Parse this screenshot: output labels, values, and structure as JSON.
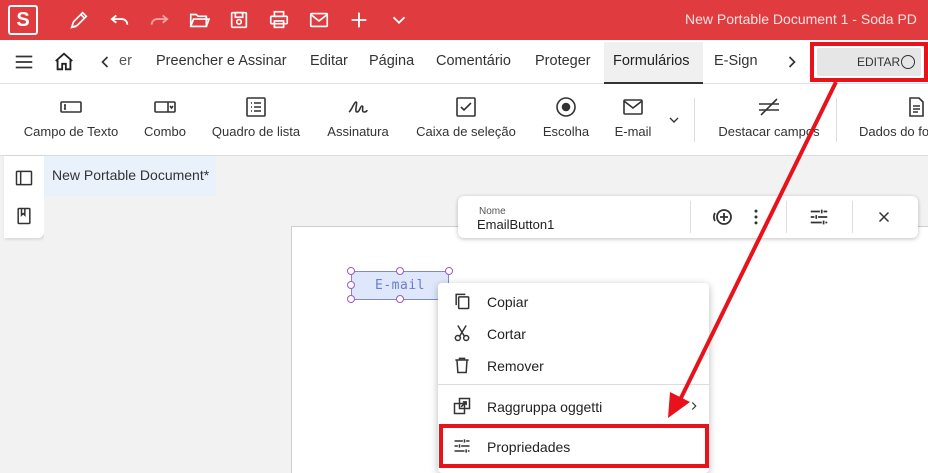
{
  "app": {
    "logo_letter": "S",
    "window_title": "New Portable Document 1  -  Soda PD"
  },
  "quick_access": [
    "pen-icon",
    "undo-icon",
    "redo-icon",
    "open-folder-icon",
    "save-icon",
    "print-icon",
    "mail-icon",
    "plus-icon",
    "chevron-down-icon"
  ],
  "nav_tabs": {
    "partial_left": "er",
    "items": [
      "Preencher e Assinar",
      "Editar",
      "Página",
      "Comentário",
      "Proteger",
      "Formulários",
      "E-Sign"
    ],
    "active": "Formulários",
    "edit_toggle_label": "EDITAR"
  },
  "ribbon": {
    "items": [
      {
        "label": "Campo de Texto",
        "icon": "text-field-icon"
      },
      {
        "label": "Combo",
        "icon": "combo-box-icon"
      },
      {
        "label": "Quadro de lista",
        "icon": "list-box-icon"
      },
      {
        "label": "Assinatura",
        "icon": "signature-icon"
      },
      {
        "label": "Caixa de seleção",
        "icon": "checkbox-icon"
      },
      {
        "label": "Escolha",
        "icon": "radio-icon"
      },
      {
        "label": "E-mail",
        "icon": "mail-icon"
      },
      {
        "label": "Destacar campos",
        "icon": "highlight-fields-icon"
      },
      {
        "label": "Dados do fo",
        "icon": "form-data-icon"
      }
    ]
  },
  "document": {
    "tab_title": "New Portable Document*",
    "email_field_text": "E-mail"
  },
  "field_toolbar": {
    "name_label": "Nome",
    "name_value": "EmailButton1"
  },
  "context_menu": {
    "items": [
      {
        "label": "Copiar",
        "icon": "copy-icon"
      },
      {
        "label": "Cortar",
        "icon": "scissors-icon"
      },
      {
        "label": "Remover",
        "icon": "trash-icon"
      },
      {
        "label": "Raggruppa oggetti",
        "icon": "group-objects-icon",
        "submenu": true
      },
      {
        "label": "Propriedades",
        "icon": "properties-icon"
      }
    ]
  },
  "colors": {
    "title_bar": "#e03c3f",
    "annotation_red": "#e8121b",
    "field_fill": "#dfe8fa",
    "field_border": "#7d89d6"
  }
}
